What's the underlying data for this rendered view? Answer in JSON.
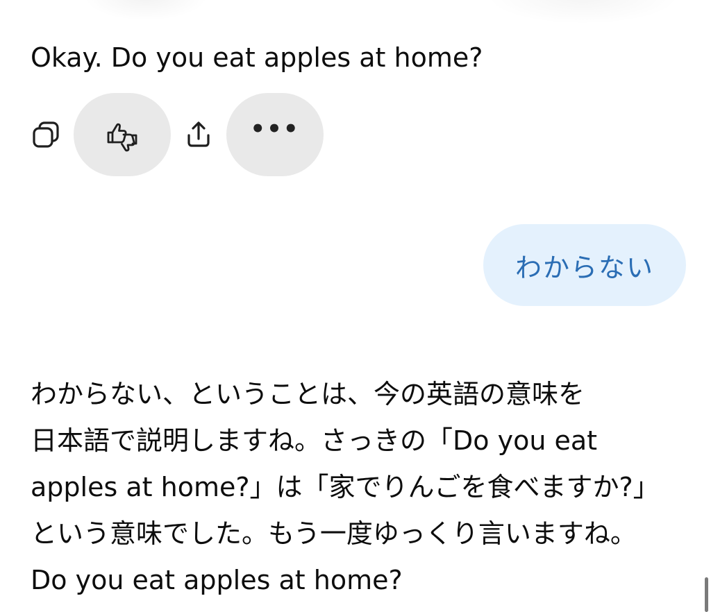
{
  "conversation": {
    "assistant_message_1": "Okay. Do you eat apples at home?",
    "actions": {
      "copy_icon": "copy-icon",
      "feedback_icon": "thumbs-up-down-icon",
      "share_icon": "share-icon",
      "more_label": "•••"
    },
    "user_message": "わからない",
    "assistant_message_2_lines": [
      "わからない、ということは、今の英語の意味を",
      "日本語で説明しますね。さっきの「Do you eat",
      "apples at home?」は「家でりんごを食べますか?」",
      "という意味でした。もう一度ゆっくり言いますね。",
      "Do you eat apples at home?"
    ]
  },
  "colors": {
    "background": "#ffffff",
    "text": "#0d0d0d",
    "user_bubble_bg": "#e4f1fd",
    "user_bubble_text": "#2a6db4",
    "action_button_bg": "#e9e9e9"
  }
}
